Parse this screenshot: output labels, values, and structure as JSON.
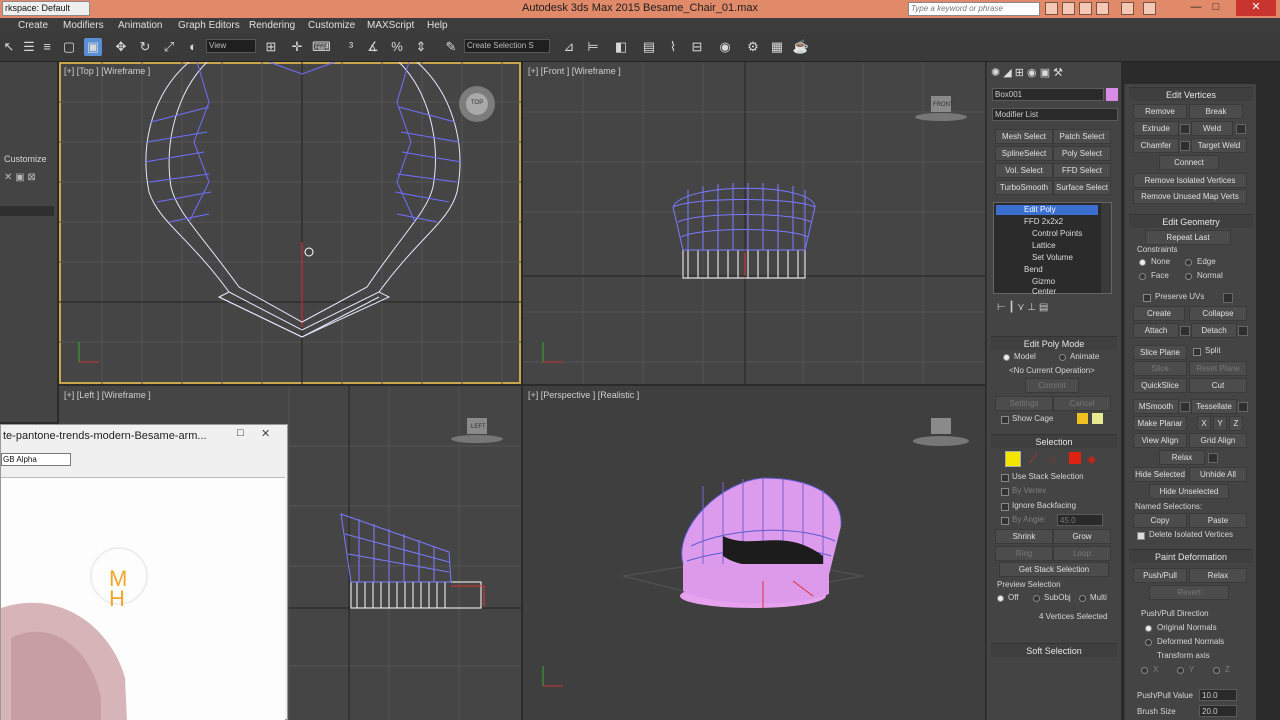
{
  "titlebar": {
    "workspace": "rkspace: Default",
    "title": "Autodesk 3ds Max  2015     Besame_Chair_01.max",
    "search_placeholder": "Type a keyword or phrase",
    "minimize": "—",
    "maximize": "□",
    "close": "✕"
  },
  "menu": [
    "Create",
    "Modifiers",
    "Animation",
    "Graph Editors",
    "Rendering",
    "Customize",
    "MAXScript",
    "Help"
  ],
  "toolbar": {
    "view_dropdown": "View",
    "selection_set": "Create Selection S"
  },
  "left_panel": {
    "customize": "Customize"
  },
  "viewports": {
    "top": "[+] [Top ] [Wireframe ]",
    "front": "[+] [Front ] [Wireframe ]",
    "left": "[+] [Left ] [Wireframe ]",
    "perspective": "[+] [Perspective ] [Realistic ]",
    "gizmo_top": "TOP",
    "gizmo_front": "FRONT",
    "gizmo_left": "LEFT"
  },
  "frame_buffer": {
    "title": "te-pantone-trends-modern-Besame-arm...",
    "channel": "GB Alpha",
    "min": "—",
    "max": "□",
    "close": "✕"
  },
  "command_panel": {
    "object_name": "Box001",
    "object_color": "#d78ce6",
    "modifier_list": "Modifier List",
    "modifier_buttons": [
      [
        "Mesh Select",
        "Patch Select"
      ],
      [
        "SplineSelect",
        "Poly Select"
      ],
      [
        "Vol. Select",
        "FFD Select"
      ],
      [
        "TurboSmooth",
        "Surface Select"
      ]
    ],
    "stack": [
      "Edit Poly",
      "FFD 2x2x2",
      "Control Points",
      "Lattice",
      "Set Volume",
      "Bend",
      "Gizmo",
      "Center"
    ],
    "edit_poly_mode": {
      "header": "Edit Poly Mode",
      "model": "Model",
      "animate": "Animate",
      "operation": "<No Current Operation>",
      "commit": "Commit",
      "settings": "Settings",
      "cancel": "Cancel",
      "show_cage": "Show Cage",
      "cage_color1": "#f0c020",
      "cage_color2": "#e8e890"
    },
    "selection": {
      "header": "Selection",
      "use_stack": "Use Stack Selection",
      "by_vertex": "By Vertex",
      "ignore_backfacing": "Ignore Backfacing",
      "by_angle": "By Angle:",
      "angle_value": "45.0",
      "shrink": "Shrink",
      "grow": "Grow",
      "ring": "Ring",
      "loop": "Loop",
      "get_stack": "Get Stack Selection",
      "preview": "Preview Selection",
      "off": "Off",
      "subobj": "SubObj",
      "multi": "Multi",
      "status": "4 Vertices Selected"
    },
    "soft_selection": "Soft Selection"
  },
  "right_panel": {
    "edit_vertices": "Edit Vertices",
    "vert_buttons": [
      [
        "Remove",
        "Break"
      ],
      [
        "Extrude",
        "Weld"
      ],
      [
        "Chamfer",
        "Target Weld"
      ]
    ],
    "connect": "Connect",
    "remove_isolated": "Remove Isolated Vertices",
    "remove_unused": "Remove Unused Map Verts",
    "edit_geometry": "Edit Geometry",
    "repeat_last": "Repeat Last",
    "constraints": "Constraints",
    "none": "None",
    "edge": "Edge",
    "face": "Face",
    "normal": "Normal",
    "preserve_uvs": "Preserve UVs",
    "create": "Create",
    "collapse": "Collapse",
    "attach": "Attach",
    "detach": "Detach",
    "slice_plane": "Slice Plane",
    "split": "Split",
    "slice": "Slice",
    "reset_plane": "Reset Plane",
    "quickslice": "QuickSlice",
    "cut": "Cut",
    "msmooth": "MSmooth",
    "tessellate": "Tessellate",
    "make_planar": "Make Planar",
    "x": "X",
    "y": "Y",
    "z": "Z",
    "view_align": "View Align",
    "grid_align": "Grid Align",
    "relax": "Relax",
    "hide_selected": "Hide Selected",
    "unhide_all": "Unhide All",
    "hide_unselected": "Hide Unselected",
    "named_selections": "Named Selections:",
    "copy": "Copy",
    "paste": "Paste",
    "delete_isolated": "Delete Isolated Vertices",
    "paint_deformation": "Paint Deformation",
    "push_pull": "Push/Pull",
    "relax2": "Relax",
    "revert": "Revert",
    "pp_direction": "Push/Pull Direction",
    "original_normals": "Original Normals",
    "deformed_normals": "Deformed Normals",
    "transform_axis": "Transform axis",
    "ax_x": "X",
    "ax_y": "Y",
    "ax_z": "Z",
    "pp_value_label": "Push/Pull Value",
    "pp_value": "10.0",
    "brush_size_label": "Brush Size",
    "brush_size": "20.0"
  }
}
